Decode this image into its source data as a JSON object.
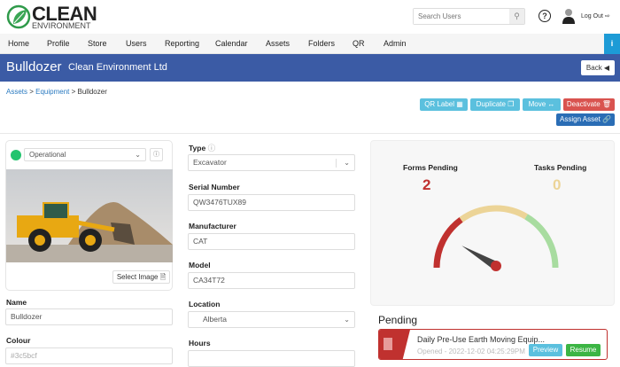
{
  "brand": {
    "name": "CLEAN",
    "tagline": "ENVIRONMENT"
  },
  "search": {
    "placeholder": "Search Users"
  },
  "header_links": {
    "logout": "Log Out"
  },
  "nav": [
    "Home",
    "Profile",
    "Store",
    "Users",
    "Reporting",
    "Calendar",
    "Assets",
    "Folders",
    "QR",
    "Admin"
  ],
  "page": {
    "title": "Bulldozer",
    "subtitle": "Clean Environment Ltd",
    "back": "Back"
  },
  "breadcrumb": [
    "Assets",
    "Equipment",
    "Bulldozer"
  ],
  "actions": {
    "qr_label": "QR Label",
    "duplicate": "Duplicate",
    "move": "Move",
    "deactivate": "Deactivate",
    "assign": "Assign Asset"
  },
  "status": {
    "value": "Operational",
    "color": "#22c46e"
  },
  "image": {
    "select_label": "Select Image"
  },
  "fields": {
    "name": {
      "label": "Name",
      "value": "Bulldozer"
    },
    "colour": {
      "label": "Colour",
      "value": "#3c5bcf"
    },
    "type": {
      "label": "Type",
      "value": "Excavator"
    },
    "serial": {
      "label": "Serial Number",
      "value": "QW3476TUX89"
    },
    "manufacturer": {
      "label": "Manufacturer",
      "value": "CAT"
    },
    "model": {
      "label": "Model",
      "value": "CA34T72"
    },
    "location": {
      "label": "Location",
      "value": "Alberta"
    },
    "hours": {
      "label": "Hours",
      "value": ""
    }
  },
  "stats": {
    "forms_label": "Forms Pending",
    "forms_value": "2",
    "tasks_label": "Tasks Pending",
    "tasks_value": "0"
  },
  "gauge": {
    "value_fraction": 0.17,
    "colors": [
      "#c0312f",
      "#ecd497",
      "#a8dca0"
    ]
  },
  "pending": {
    "title": "Pending",
    "items": [
      {
        "name": "Daily Pre-Use Earth Moving Equip...",
        "opened": "Opened - 2022-12-02 04:25:29PM",
        "preview": "Preview",
        "resume": "Resume"
      }
    ]
  }
}
